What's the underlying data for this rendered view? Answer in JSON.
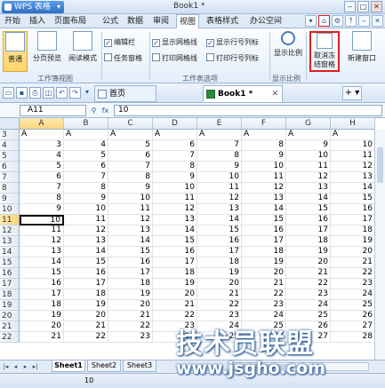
{
  "app": {
    "name": "WPS 表格",
    "doc_title": "Book1 *"
  },
  "menu": {
    "tabs": [
      "开始",
      "插入",
      "页面布局",
      "公式",
      "数据",
      "审阅",
      "视图",
      "表格样式",
      "办公空间"
    ],
    "active_tab": "视图"
  },
  "ribbon": {
    "view_buttons": [
      "普通",
      "分页预览",
      "阅读模式"
    ],
    "checks": [
      {
        "label": "编辑栏",
        "checked": true
      },
      {
        "label": "任务窗格",
        "checked": false
      },
      {
        "label": "显示网格线",
        "checked": true
      },
      {
        "label": "打印网格线",
        "checked": false
      },
      {
        "label": "显示行号列标",
        "checked": true
      },
      {
        "label": "打印行号列标",
        "checked": false
      }
    ],
    "zoom_label": "显示比例",
    "unfreeze_label": "取消冻结窗格",
    "newwin_label": "新建窗口",
    "groups": [
      "工作簿视图",
      "工作表选项",
      "显示比例"
    ]
  },
  "tabs": {
    "home": "首页",
    "book": "Book1 *"
  },
  "formula": {
    "cell_ref": "A11",
    "fx": "fx",
    "value": "10"
  },
  "grid": {
    "columns": [
      "A",
      "B",
      "C",
      "D",
      "E",
      "F",
      "G",
      "H"
    ],
    "rows": [
      {
        "n": "3",
        "cells": [
          "A",
          "A",
          "A",
          "A",
          "A",
          "A",
          "A",
          "A"
        ]
      },
      {
        "n": "4",
        "cells": [
          "3",
          "4",
          "5",
          "6",
          "7",
          "8",
          "9",
          "10"
        ]
      },
      {
        "n": "5",
        "cells": [
          "4",
          "5",
          "6",
          "7",
          "8",
          "9",
          "10",
          "11"
        ]
      },
      {
        "n": "6",
        "cells": [
          "5",
          "6",
          "7",
          "8",
          "9",
          "10",
          "11",
          "12"
        ]
      },
      {
        "n": "7",
        "cells": [
          "6",
          "7",
          "8",
          "9",
          "10",
          "11",
          "12",
          "13"
        ]
      },
      {
        "n": "8",
        "cells": [
          "7",
          "8",
          "9",
          "10",
          "11",
          "12",
          "13",
          "14"
        ]
      },
      {
        "n": "9",
        "cells": [
          "8",
          "9",
          "10",
          "11",
          "12",
          "13",
          "14",
          "15"
        ]
      },
      {
        "n": "10",
        "cells": [
          "9",
          "10",
          "11",
          "12",
          "13",
          "14",
          "15",
          "16"
        ]
      },
      {
        "n": "11",
        "cells": [
          "10",
          "11",
          "12",
          "13",
          "14",
          "15",
          "16",
          "17"
        ]
      },
      {
        "n": "12",
        "cells": [
          "11",
          "12",
          "13",
          "14",
          "15",
          "16",
          "17",
          "18"
        ]
      },
      {
        "n": "13",
        "cells": [
          "12",
          "13",
          "14",
          "15",
          "16",
          "17",
          "18",
          "19"
        ]
      },
      {
        "n": "14",
        "cells": [
          "13",
          "14",
          "15",
          "16",
          "17",
          "18",
          "19",
          "20"
        ]
      },
      {
        "n": "15",
        "cells": [
          "14",
          "15",
          "16",
          "17",
          "18",
          "19",
          "20",
          "21"
        ]
      },
      {
        "n": "16",
        "cells": [
          "15",
          "16",
          "17",
          "18",
          "19",
          "20",
          "21",
          "22"
        ]
      },
      {
        "n": "17",
        "cells": [
          "16",
          "17",
          "18",
          "19",
          "20",
          "21",
          "22",
          "23"
        ]
      },
      {
        "n": "18",
        "cells": [
          "17",
          "18",
          "19",
          "20",
          "21",
          "22",
          "23",
          "24"
        ]
      },
      {
        "n": "19",
        "cells": [
          "18",
          "19",
          "20",
          "21",
          "22",
          "23",
          "24",
          "25"
        ]
      },
      {
        "n": "20",
        "cells": [
          "19",
          "20",
          "21",
          "22",
          "23",
          "24",
          "25",
          "26"
        ]
      },
      {
        "n": "21",
        "cells": [
          "20",
          "21",
          "22",
          "23",
          "24",
          "25",
          "26",
          "27"
        ]
      },
      {
        "n": "22",
        "cells": [
          "21",
          "22",
          "23",
          "24",
          "25",
          "26",
          "27",
          "28"
        ]
      }
    ],
    "active_row": "11",
    "active_col": "A"
  },
  "sheets": [
    "Sheet1",
    "Sheet2",
    "Sheet3"
  ],
  "active_sheet": "Sheet1",
  "status": {
    "value": "10"
  },
  "watermark": {
    "title": "技术员联盟",
    "url": "www.jsgho.com"
  }
}
